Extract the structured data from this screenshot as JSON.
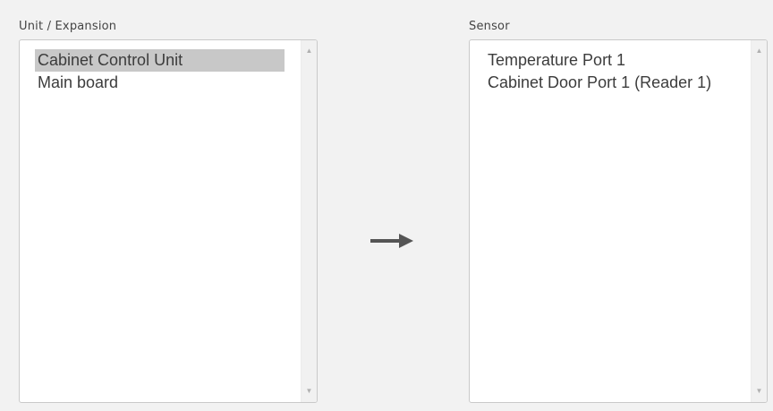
{
  "unit_panel": {
    "label": "Unit / Expansion",
    "items": [
      {
        "label": "Cabinet Control Unit",
        "selected": true
      },
      {
        "label": "Main board",
        "selected": false
      }
    ]
  },
  "sensor_panel": {
    "label": "Sensor",
    "items": [
      {
        "label": "Temperature Port 1",
        "selected": false
      },
      {
        "label": "Cabinet Door Port 1 (Reader 1)",
        "selected": false
      }
    ]
  },
  "icons": {
    "scroll_up": "scroll-up-arrow-icon",
    "scroll_down": "scroll-down-arrow-icon",
    "transfer": "right-arrow-icon"
  },
  "colors": {
    "background": "#f2f2f2",
    "selection": "#c8c8c8",
    "text": "#3c3c3c",
    "arrow": "#555555"
  }
}
